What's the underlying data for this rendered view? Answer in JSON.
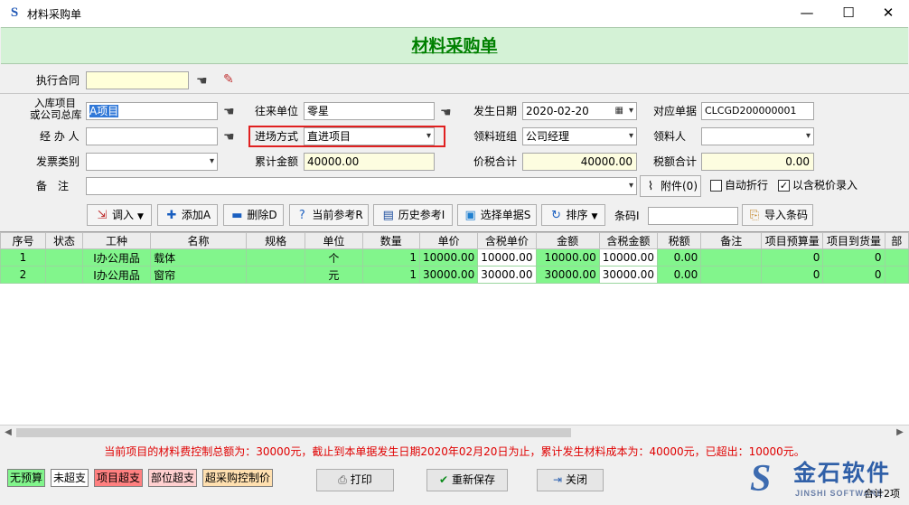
{
  "window": {
    "title": "材料采购单",
    "app_icon": "S",
    "min": "—",
    "max": "☐",
    "close": "✕"
  },
  "form": {
    "title": "材料采购单"
  },
  "fields": {
    "contract": {
      "label": "执行合同",
      "value": ""
    },
    "warehouse": {
      "label_line1": "入库项目",
      "label_line2": "或公司总库",
      "value": "A项目"
    },
    "partner": {
      "label": "往来单位",
      "value": "零星"
    },
    "date": {
      "label": "发生日期",
      "value": "2020-02-20"
    },
    "ref_doc": {
      "label": "对应单据",
      "value": "CLCGD200000001"
    },
    "handler": {
      "label": "经 办 人",
      "value": ""
    },
    "entry_mode": {
      "label": "进场方式",
      "value": "直进项目"
    },
    "team": {
      "label": "领料班组",
      "value": "公司经理"
    },
    "receiver": {
      "label": "领料人",
      "value": ""
    },
    "invoice_type": {
      "label": "发票类别",
      "value": ""
    },
    "total_amount": {
      "label": "累计金额",
      "value": "40000.00"
    },
    "price_tax_total": {
      "label": "价税合计",
      "value": "40000.00"
    },
    "tax_total": {
      "label": "税额合计",
      "value": "0.00"
    },
    "remark": {
      "label": "备　注",
      "value": ""
    },
    "attachment": {
      "label": "附件(0)"
    },
    "auto_discount": {
      "label": "自动折行",
      "checked": false
    },
    "tax_price_entry": {
      "label": "以含税价录入",
      "checked": true
    }
  },
  "toolbar": {
    "import": "调入",
    "add": "添加A",
    "delete": "删除D",
    "current_ref": "当前参考R",
    "history_ref": "历史参考I",
    "select_doc": "选择单据S",
    "sort": "排序",
    "barcode_label": "条码I",
    "barcode_value": "",
    "import_barcode": "导入条码"
  },
  "table": {
    "columns": [
      "序号",
      "状态",
      "工种",
      "名称",
      "规格",
      "单位",
      "数量",
      "单价",
      "含税单价",
      "金额",
      "含税金额",
      "税额",
      "备注",
      "项目预算量",
      "项目到货量",
      "部"
    ],
    "rows": [
      {
        "no": "1",
        "status": "",
        "trade": "I办公用品",
        "name": "载体",
        "spec": "",
        "unit": "个",
        "qty": "1",
        "price": "10000.00",
        "tax_price": "10000.00",
        "amount": "10000.00",
        "tax_amount": "10000.00",
        "tax": "0.00",
        "note": "",
        "budget": "0",
        "arrived": "0"
      },
      {
        "no": "2",
        "status": "",
        "trade": "I办公用品",
        "name": "窗帘",
        "spec": "",
        "unit": "元",
        "qty": "1",
        "price": "30000.00",
        "tax_price": "30000.00",
        "amount": "30000.00",
        "tax_amount": "30000.00",
        "tax": "0.00",
        "note": "",
        "budget": "0",
        "arrived": "0"
      }
    ]
  },
  "status_message": "当前项目的材料费控制总额为：30000元，截止到本单据发生日期2020年02月20日为止，累计发生材料成本为：40000元，已超出：10000元。",
  "legend": [
    {
      "label": "无预算",
      "color": "#82f58c"
    },
    {
      "label": "未超支",
      "color": "#ffffff"
    },
    {
      "label": "项目超支",
      "color": "#ff8080"
    },
    {
      "label": "部位超支",
      "color": "#ffd0d0"
    },
    {
      "label": "超采购控制价",
      "color": "#ffe0b0"
    }
  ],
  "buttons": {
    "print": "打印",
    "resave": "重新保存",
    "close": "关闭"
  },
  "logo": {
    "cn": "金石软件",
    "en": "JINSHI SOFTWARE"
  },
  "footer": {
    "count": "合计2项"
  },
  "colors": {
    "title_green": "#008000",
    "row_green": "#82f58c",
    "alert_red": "#e00000",
    "highlight_red": "#e02020"
  }
}
